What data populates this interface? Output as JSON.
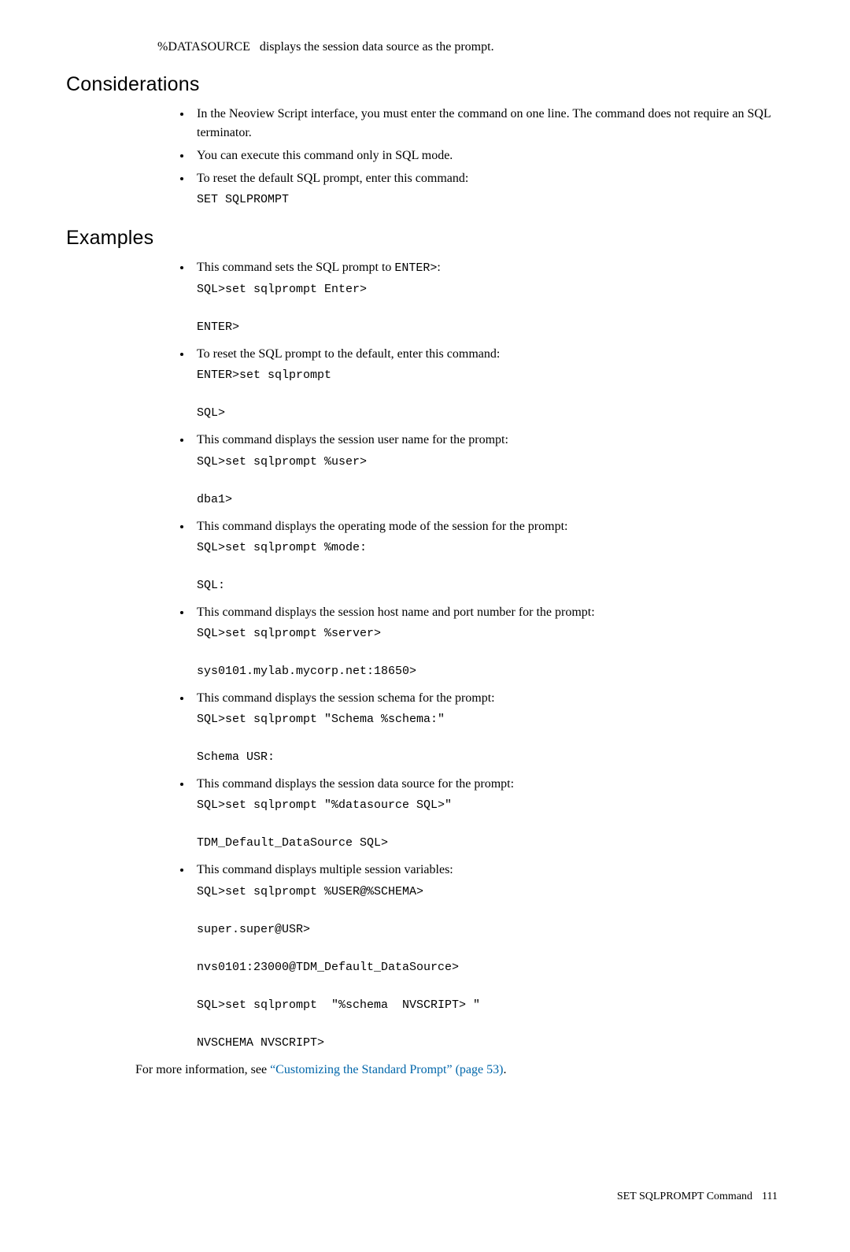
{
  "intro": {
    "var": "%DATASOURCE",
    "desc": "displays the session data source as the prompt."
  },
  "considerations": {
    "heading": "Considerations",
    "items": [
      "In the Neoview Script interface, you must enter the command on one line. The command does not require an SQL terminator.",
      "You can execute this command only in SQL mode.",
      "To reset the default SQL prompt, enter this command:"
    ],
    "code": "SET SQLPROMPT"
  },
  "examples": {
    "heading": "Examples",
    "items": [
      {
        "lead": "This command sets the SQL prompt to ",
        "inline_code": "ENTER>",
        "tail": ":",
        "code": "SQL>set sqlprompt Enter>\n\nENTER>"
      },
      {
        "lead": "To reset the SQL prompt to the default, enter this command:",
        "code": "ENTER>set sqlprompt\n\nSQL>"
      },
      {
        "lead": "This command displays the session user name for the prompt:",
        "code": "SQL>set sqlprompt %user>\n\ndba1>"
      },
      {
        "lead": "This command displays the operating mode of the session for the prompt:",
        "code": "SQL>set sqlprompt %mode:\n\nSQL:"
      },
      {
        "lead": "This command displays the session host name and port number for the prompt:",
        "code": "SQL>set sqlprompt %server>\n\nsys0101.mylab.mycorp.net:18650>"
      },
      {
        "lead": "This command displays the session schema for the prompt:",
        "code": "SQL>set sqlprompt \"Schema %schema:\"\n\nSchema USR:"
      },
      {
        "lead": "This command displays the session data source for the prompt:",
        "code": "SQL>set sqlprompt \"%datasource SQL>\"\n\nTDM_Default_DataSource SQL>"
      },
      {
        "lead": "This command displays multiple session variables:",
        "code": "SQL>set sqlprompt %USER@%SCHEMA>\n\nsuper.super@USR>\n\nnvs0101:23000@TDM_Default_DataSource>\n\nSQL>set sqlprompt  \"%schema  NVSCRIPT> \"\n\nNVSCHEMA NVSCRIPT>"
      }
    ]
  },
  "closing": {
    "pre": "For more information, see ",
    "link": "“Customizing the Standard Prompt” (page 53)",
    "post": "."
  },
  "footer": {
    "label": "SET SQLPROMPT Command",
    "page": "111"
  }
}
